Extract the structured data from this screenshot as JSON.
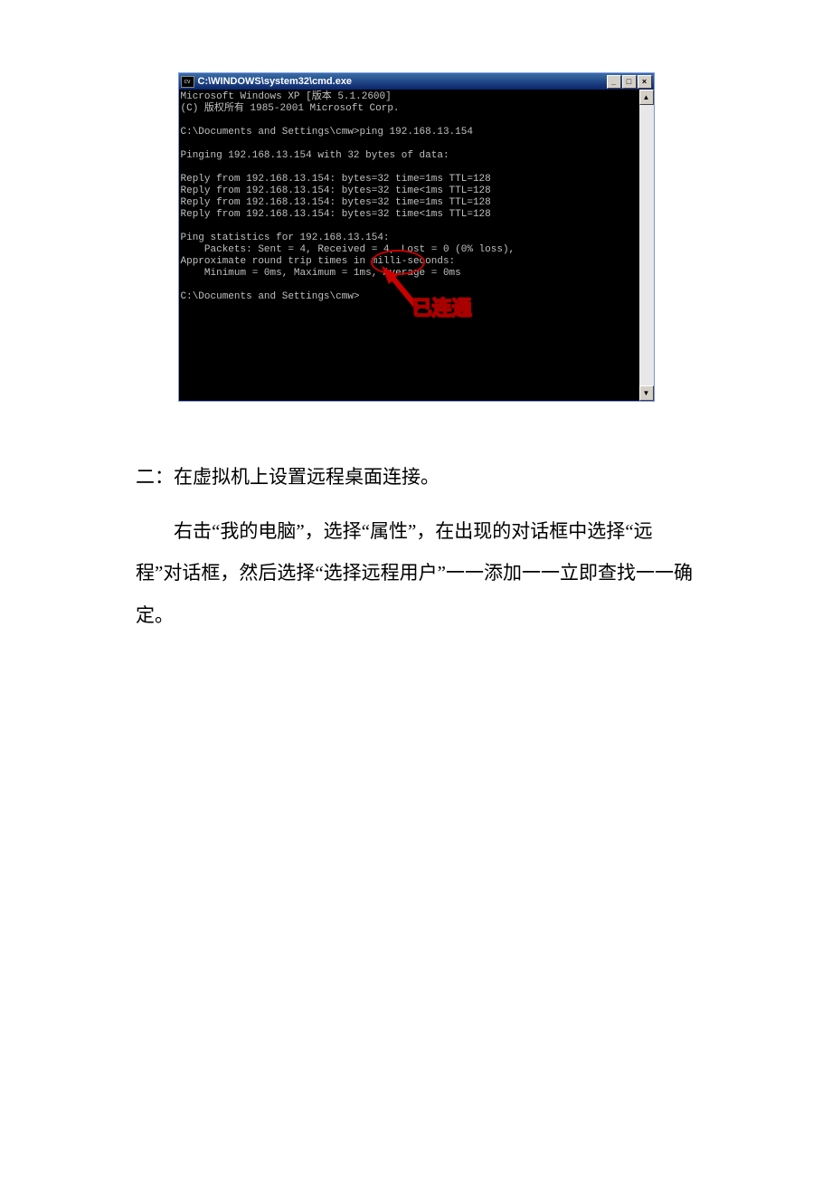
{
  "cmd": {
    "title_prefix": "C:\\",
    "title_path": "C:\\WINDOWS\\system32\\cmd.exe",
    "icon_label": "cv",
    "lines": {
      "l1": "Microsoft Windows XP [版本 5.1.2600]",
      "l2": "(C) 版权所有 1985-2001 Microsoft Corp.",
      "l3": "",
      "l4": "C:\\Documents and Settings\\cmw>ping 192.168.13.154",
      "l5": "",
      "l6": "Pinging 192.168.13.154 with 32 bytes of data:",
      "l7": "",
      "l8": "Reply from 192.168.13.154: bytes=32 time=1ms TTL=128",
      "l9": "Reply from 192.168.13.154: bytes=32 time<1ms TTL=128",
      "l10": "Reply from 192.168.13.154: bytes=32 time=1ms TTL=128",
      "l11": "Reply from 192.168.13.154: bytes=32 time<1ms TTL=128",
      "l12": "",
      "l13": "Ping statistics for 192.168.13.154:",
      "l14": "    Packets: Sent = 4, Received = 4, Lost = 0 (0% loss),",
      "l15": "Approximate round trip times in milli-seconds:",
      "l16": "    Minimum = 0ms, Maximum = 1ms, Average = 0ms",
      "l17": "",
      "l18": "C:\\Documents and Settings\\cmw>"
    },
    "annotation": "已连通"
  },
  "doc": {
    "heading": "二：在虚拟机上设置远程桌面连接。",
    "para1": "右击“我的电脑”，选择“属性”，在出现的对话框中选择“远程”对话框，然后选择“选择远程用户”一一添加一一立即查找一一确定。"
  },
  "winbtn": {
    "min": "_",
    "max": "□",
    "close": "×",
    "up": "▲",
    "down": "▼"
  }
}
